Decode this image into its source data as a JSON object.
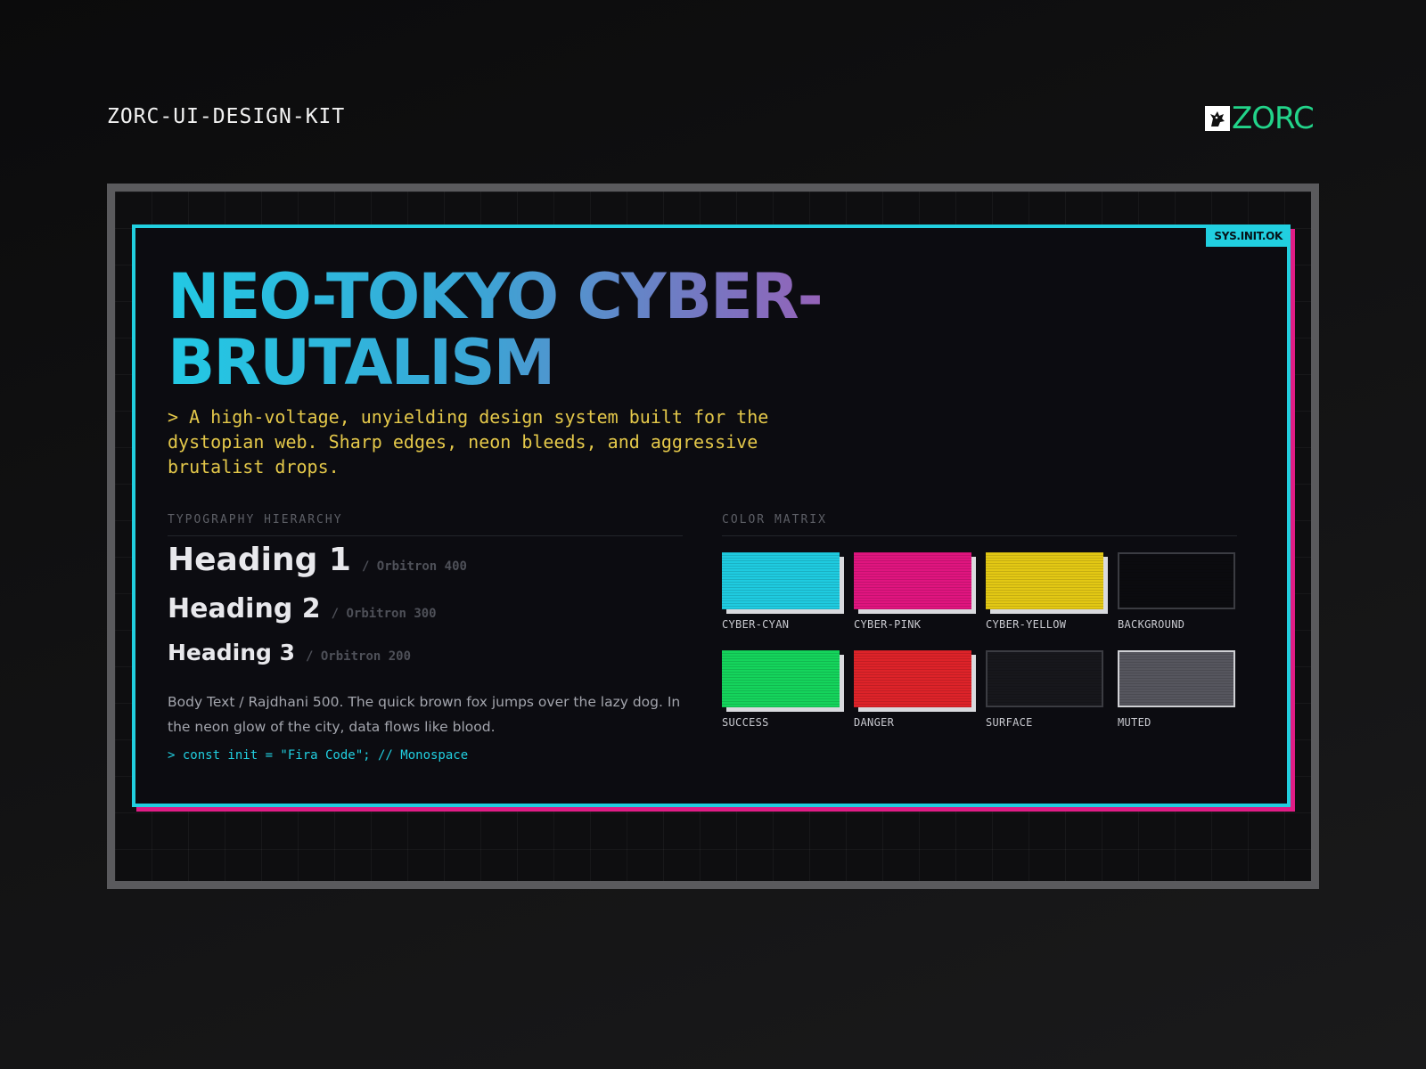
{
  "header": {
    "kit_title": "ZORC-UI-DESIGN-KIT",
    "brand_name": "ZORC",
    "brand_icon": "wolf-logo-icon",
    "brand_color": "#22d48a"
  },
  "card": {
    "badge": "SYS.INIT.OK",
    "title_line1": "NEO-TOKYO CYBER-",
    "title_line2": "BRUTALISM",
    "description": "> A high-voltage, unyielding design system built for the dystopian web. Sharp edges, neon bleeds, and aggressive brutalist drops."
  },
  "typography": {
    "section_label": "TYPOGRAPHY HIERARCHY",
    "h1": {
      "text": "Heading 1",
      "meta": "/ Orbitron 400"
    },
    "h2": {
      "text": "Heading 2",
      "meta": "/ Orbitron 300"
    },
    "h3": {
      "text": "Heading 3",
      "meta": "/ Orbitron 200"
    },
    "body": "Body Text / Rajdhani 500. The quick brown fox jumps over the lazy dog. In the neon glow of the city, data flows like blood.",
    "code": "> const init = \"Fira Code\"; // Monospace"
  },
  "colors": {
    "section_label": "COLOR MATRIX",
    "swatches": [
      {
        "name": "CYBER-CYAN",
        "hex": "#1fcbe0"
      },
      {
        "name": "CYBER-PINK",
        "hex": "#e0157f"
      },
      {
        "name": "CYBER-YELLOW",
        "hex": "#e3c814"
      },
      {
        "name": "BACKGROUND",
        "hex": "#0b0b0f"
      },
      {
        "name": "SUCCESS",
        "hex": "#15d45c"
      },
      {
        "name": "DANGER",
        "hex": "#de2329"
      },
      {
        "name": "SURFACE",
        "hex": "#17171c"
      },
      {
        "name": "MUTED",
        "hex": "#56565e"
      }
    ]
  }
}
